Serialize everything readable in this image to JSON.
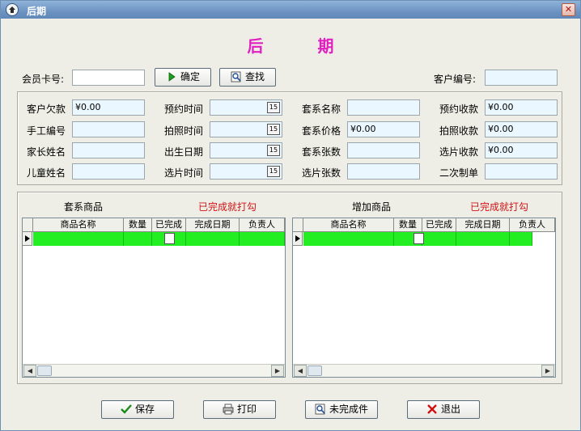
{
  "window": {
    "title": "后期",
    "close_glyph": "✕"
  },
  "heading": "后 期",
  "top": {
    "card_label": "会员卡号:",
    "card_value": "",
    "confirm_label": "确定",
    "search_label": "查找",
    "customer_no_label": "客户编号:",
    "customer_no_value": ""
  },
  "form": {
    "col1": [
      {
        "label": "客户欠款",
        "value": "¥0.00"
      },
      {
        "label": "手工编号",
        "value": ""
      },
      {
        "label": "家长姓名",
        "value": ""
      },
      {
        "label": "儿童姓名",
        "value": ""
      }
    ],
    "col2": [
      {
        "label": "预约时间",
        "value": ""
      },
      {
        "label": "拍照时间",
        "value": ""
      },
      {
        "label": "出生日期",
        "value": ""
      },
      {
        "label": "选片时间",
        "value": ""
      }
    ],
    "col3": [
      {
        "label": "套系名称",
        "value": ""
      },
      {
        "label": "套系价格",
        "value": "¥0.00"
      },
      {
        "label": "套系张数",
        "value": ""
      },
      {
        "label": "选片张数",
        "value": ""
      }
    ],
    "col4": [
      {
        "label": "预约收款",
        "value": "¥0.00"
      },
      {
        "label": "拍照收款",
        "value": "¥0.00"
      },
      {
        "label": "选片收款",
        "value": "¥0.00"
      },
      {
        "label": "二次制单",
        "value": ""
      }
    ],
    "calendar_glyph": "15"
  },
  "grids": {
    "left": {
      "title": "套系商品",
      "note": "已完成就打勾"
    },
    "right": {
      "title": "增加商品",
      "note": "已完成就打勾"
    },
    "columns": [
      "商品名称",
      "数量",
      "已完成",
      "完成日期",
      "负责人"
    ]
  },
  "buttons": {
    "save": "保存",
    "print": "打印",
    "unfinished": "未完成件",
    "exit": "退出"
  },
  "colors": {
    "heading": "#e020c0",
    "row_highlight": "#22ee22",
    "note_red": "#d01414"
  }
}
